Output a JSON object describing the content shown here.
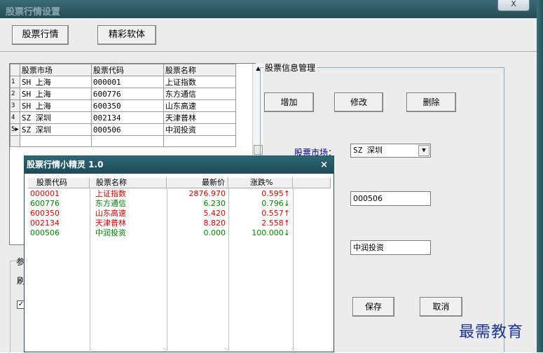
{
  "window": {
    "title": "股票行情设置",
    "close_label": "X"
  },
  "toolbar": {
    "stock_quotes": "股票行情",
    "software": "精彩软体"
  },
  "grid": {
    "headers": [
      "股票市场",
      "股票代码",
      "股票名称"
    ],
    "rows": [
      {
        "idx": "1",
        "market": "SH 上海",
        "code": "000001",
        "name": "上证指数"
      },
      {
        "idx": "2",
        "market": "SH 上海",
        "code": "600776",
        "name": "东方通信"
      },
      {
        "idx": "3",
        "market": "SH 上海",
        "code": "600350",
        "name": "山东高速"
      },
      {
        "idx": "4",
        "market": "SZ 深圳",
        "code": "002134",
        "name": "天津普林"
      },
      {
        "idx": "5▶",
        "market": "SZ 深圳",
        "code": "000506",
        "name": "中润投资"
      }
    ],
    "scroll_up": "▲"
  },
  "manage": {
    "legend": "股票信息管理",
    "add": "增加",
    "edit": "修改",
    "delete": "删除",
    "market_label": "股票市场：",
    "market_value": "SZ 深圳",
    "code_value": "000506",
    "name_value": "中润投资",
    "save": "保存",
    "cancel": "取消"
  },
  "left": {
    "legend": "参",
    "refresh": "刷",
    "check": "✓"
  },
  "popup": {
    "title": "股票行情小精灵 1.0",
    "close": "×",
    "headers": [
      "股票代码",
      "股票名称",
      "最新价",
      "涨跌%"
    ],
    "rows": [
      {
        "code": "000001",
        "name": "上证指数",
        "price": "2876.970",
        "change": "0.595↑",
        "color": "#e00000"
      },
      {
        "code": "600776",
        "name": "东方通信",
        "price": "6.230",
        "change": "0.796↓",
        "color": "#008000"
      },
      {
        "code": "600350",
        "name": "山东高速",
        "price": "5.420",
        "change": "0.557↑",
        "color": "#e00000"
      },
      {
        "code": "002134",
        "name": "天津普林",
        "price": "8.820",
        "change": "2.558↑",
        "color": "#e00000"
      },
      {
        "code": "000506",
        "name": "中润投资",
        "price": "0.000",
        "change": "100.000↓",
        "color": "#008000"
      }
    ]
  },
  "watermark": "最需教育"
}
